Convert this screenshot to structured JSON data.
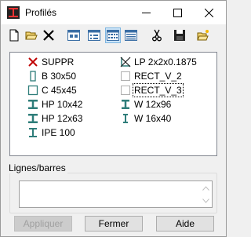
{
  "window": {
    "title": "Profilés"
  },
  "title_controls": [
    "minimize-icon",
    "maximize-icon",
    "close-icon"
  ],
  "toolbar": {
    "tools": [
      {
        "name": "new-icon"
      },
      {
        "name": "open-folder-icon"
      },
      {
        "name": "delete-icon"
      },
      {
        "name": "large-icons-view-icon"
      },
      {
        "name": "small-icons-view-icon",
        "pressed": false
      },
      {
        "name": "list-view-icon",
        "pressed": true
      },
      {
        "name": "details-view-icon"
      },
      {
        "name": "cut-icon"
      },
      {
        "name": "save-icon"
      },
      {
        "name": "open-folder-star-icon"
      }
    ]
  },
  "profiles": [
    {
      "label": "SUPPR",
      "icon": "red-x-icon"
    },
    {
      "label": "B 30x50",
      "icon": "rect-section-icon"
    },
    {
      "label": "C 45x45",
      "icon": "square-section-icon"
    },
    {
      "label": "HP 10x42",
      "icon": "h-beam-icon"
    },
    {
      "label": "HP 12x63",
      "icon": "h-beam-icon"
    },
    {
      "label": "IPE 100",
      "icon": "i-beam-icon"
    },
    {
      "label": "LP 2x2x0.1875",
      "icon": "angle-section-crossed-icon"
    },
    {
      "label": "RECT_V_2",
      "icon": "empty-rect-icon"
    },
    {
      "label": "RECT_V_3",
      "icon": "empty-rect-icon",
      "focused": true
    },
    {
      "label": "W 12x96",
      "icon": "w-beam-icon"
    },
    {
      "label": "W 16x40",
      "icon": "w-beam-narrow-icon"
    }
  ],
  "lines_group": {
    "label": "Lignes/barres",
    "value": ""
  },
  "buttons": {
    "apply": "Appliquer",
    "close": "Fermer",
    "help": "Aide"
  },
  "colors": {
    "accent_teal": "#2e7d7a",
    "delete_red": "#c00000",
    "pressed_blue": "#cce4f7"
  }
}
